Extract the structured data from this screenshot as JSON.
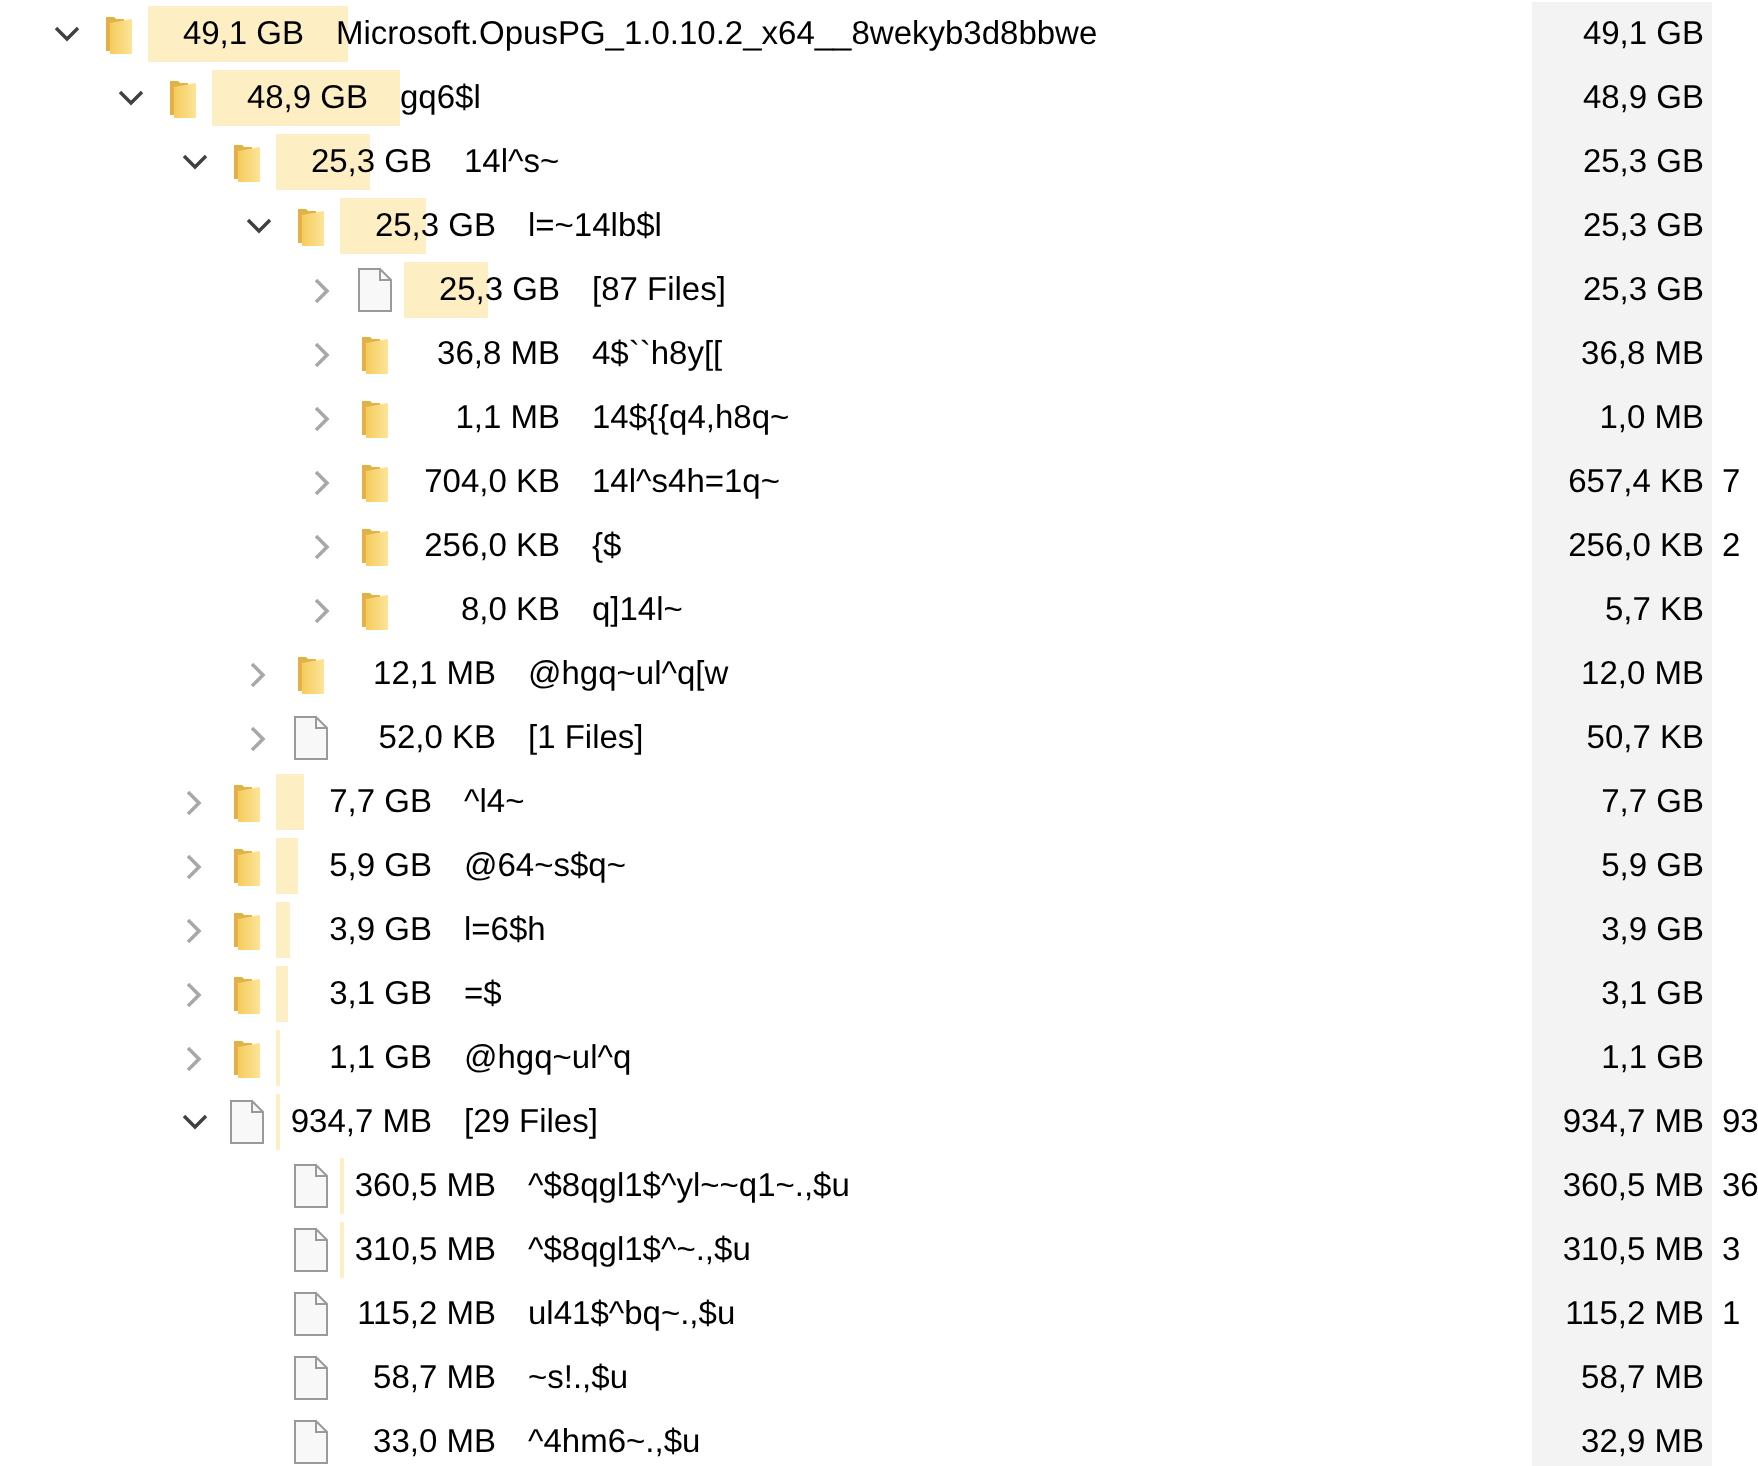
{
  "tree": [
    {
      "kind": "folder",
      "expanded": true,
      "level": 1,
      "size": "49,1 GB",
      "name": "Microsoft.OpusPG_1.0.10.2_x64__8wekyb3d8bbwe",
      "column_2": "49,1 GB",
      "children": [
        {
          "kind": "folder",
          "expanded": true,
          "level": 0.94,
          "size": "48,9 GB",
          "name": "gq6$l",
          "column_2": "48,9 GB",
          "children": [
            {
              "kind": "folder",
              "expanded": true,
              "level": 0.47,
              "size": "25,3 GB",
              "name": "14l^s~",
              "column_2": "25,3 GB",
              "children": [
                {
                  "kind": "folder",
                  "expanded": true,
                  "level": 0.43,
                  "size": "25,3 GB",
                  "name": "l=~14lb$l",
                  "column_2": "25,3 GB",
                  "children": [
                    {
                      "kind": "file",
                      "expanded": false,
                      "level": 0.42,
                      "size": "25,3 GB",
                      "name": "[87 Files]",
                      "column_2": "25,3 GB"
                    },
                    {
                      "kind": "folder",
                      "expanded": false,
                      "size": "36,8 MB",
                      "name": "4$``h8y[[",
                      "column_2": "36,8 MB"
                    },
                    {
                      "kind": "folder",
                      "expanded": false,
                      "size": "1,1 MB",
                      "name": "14${{q4,h8q~",
                      "column_2": "1,0 MB"
                    },
                    {
                      "kind": "folder",
                      "expanded": false,
                      "size": "704,0 KB",
                      "name": "14l^s4h=1q~",
                      "column_2": "657,4 KB",
                      "column_3": "7"
                    },
                    {
                      "kind": "folder",
                      "expanded": false,
                      "size": "256,0 KB",
                      "name": "{$",
                      "column_2": "256,0 KB",
                      "column_3": "2"
                    },
                    {
                      "kind": "folder",
                      "expanded": false,
                      "size": "8,0 KB",
                      "name": "q]14l~",
                      "column_2": "5,7 KB"
                    }
                  ]
                },
                {
                  "kind": "folder",
                  "expanded": false,
                  "size": "12,1 MB",
                  "name": "@hgq~ul^q[w",
                  "column_2": "12,0 MB"
                },
                {
                  "kind": "file",
                  "expanded": false,
                  "size": "52,0 KB",
                  "name": "[1 Files]",
                  "column_2": "50,7 KB"
                }
              ]
            },
            {
              "kind": "folder",
              "expanded": false,
              "level": 0.14,
              "size": "7,7 GB",
              "name": "^l4~",
              "column_2": "7,7 GB"
            },
            {
              "kind": "folder",
              "expanded": false,
              "level": 0.11,
              "size": "5,9 GB",
              "name": "@64~s$q~",
              "column_2": "5,9 GB"
            },
            {
              "kind": "folder",
              "expanded": false,
              "level": 0.07,
              "size": "3,9 GB",
              "name": "l=6$h",
              "column_2": "3,9 GB"
            },
            {
              "kind": "folder",
              "expanded": false,
              "level": 0.06,
              "size": "3,1 GB",
              "name": "=$",
              "column_2": "3,1 GB"
            },
            {
              "kind": "folder",
              "expanded": false,
              "level": 0.02,
              "size": "1,1 GB",
              "name": "@hgq~ul^q",
              "column_2": "1,1 GB"
            },
            {
              "kind": "file",
              "expanded": true,
              "level": 0.02,
              "size": "934,7 MB",
              "name": "[29 Files]",
              "column_2": "934,7 MB",
              "column_3": "93",
              "children": [
                {
                  "kind": "file",
                  "level": 0.015,
                  "size": "360,5 MB",
                  "name": "^$8qgl1$^yl~~q1~.,$u",
                  "column_2": "360,5 MB",
                  "column_3": "36"
                },
                {
                  "kind": "file",
                  "level": 0.015,
                  "size": "310,5 MB",
                  "name": "^$8qgl1$^~.,$u",
                  "column_2": "310,5 MB",
                  "column_3": "3"
                },
                {
                  "kind": "file",
                  "size": "115,2 MB",
                  "name": "ul41$^bq~.,$u",
                  "column_2": "115,2 MB",
                  "column_3": "1"
                },
                {
                  "kind": "file",
                  "size": "58,7 MB",
                  "name": "~s!.,$u",
                  "column_2": "58,7 MB"
                },
                {
                  "kind": "file",
                  "size": "33,0 MB",
                  "name": "^4hm6~.,$u",
                  "column_2": "32,9 MB"
                }
              ]
            }
          ]
        }
      ]
    }
  ]
}
